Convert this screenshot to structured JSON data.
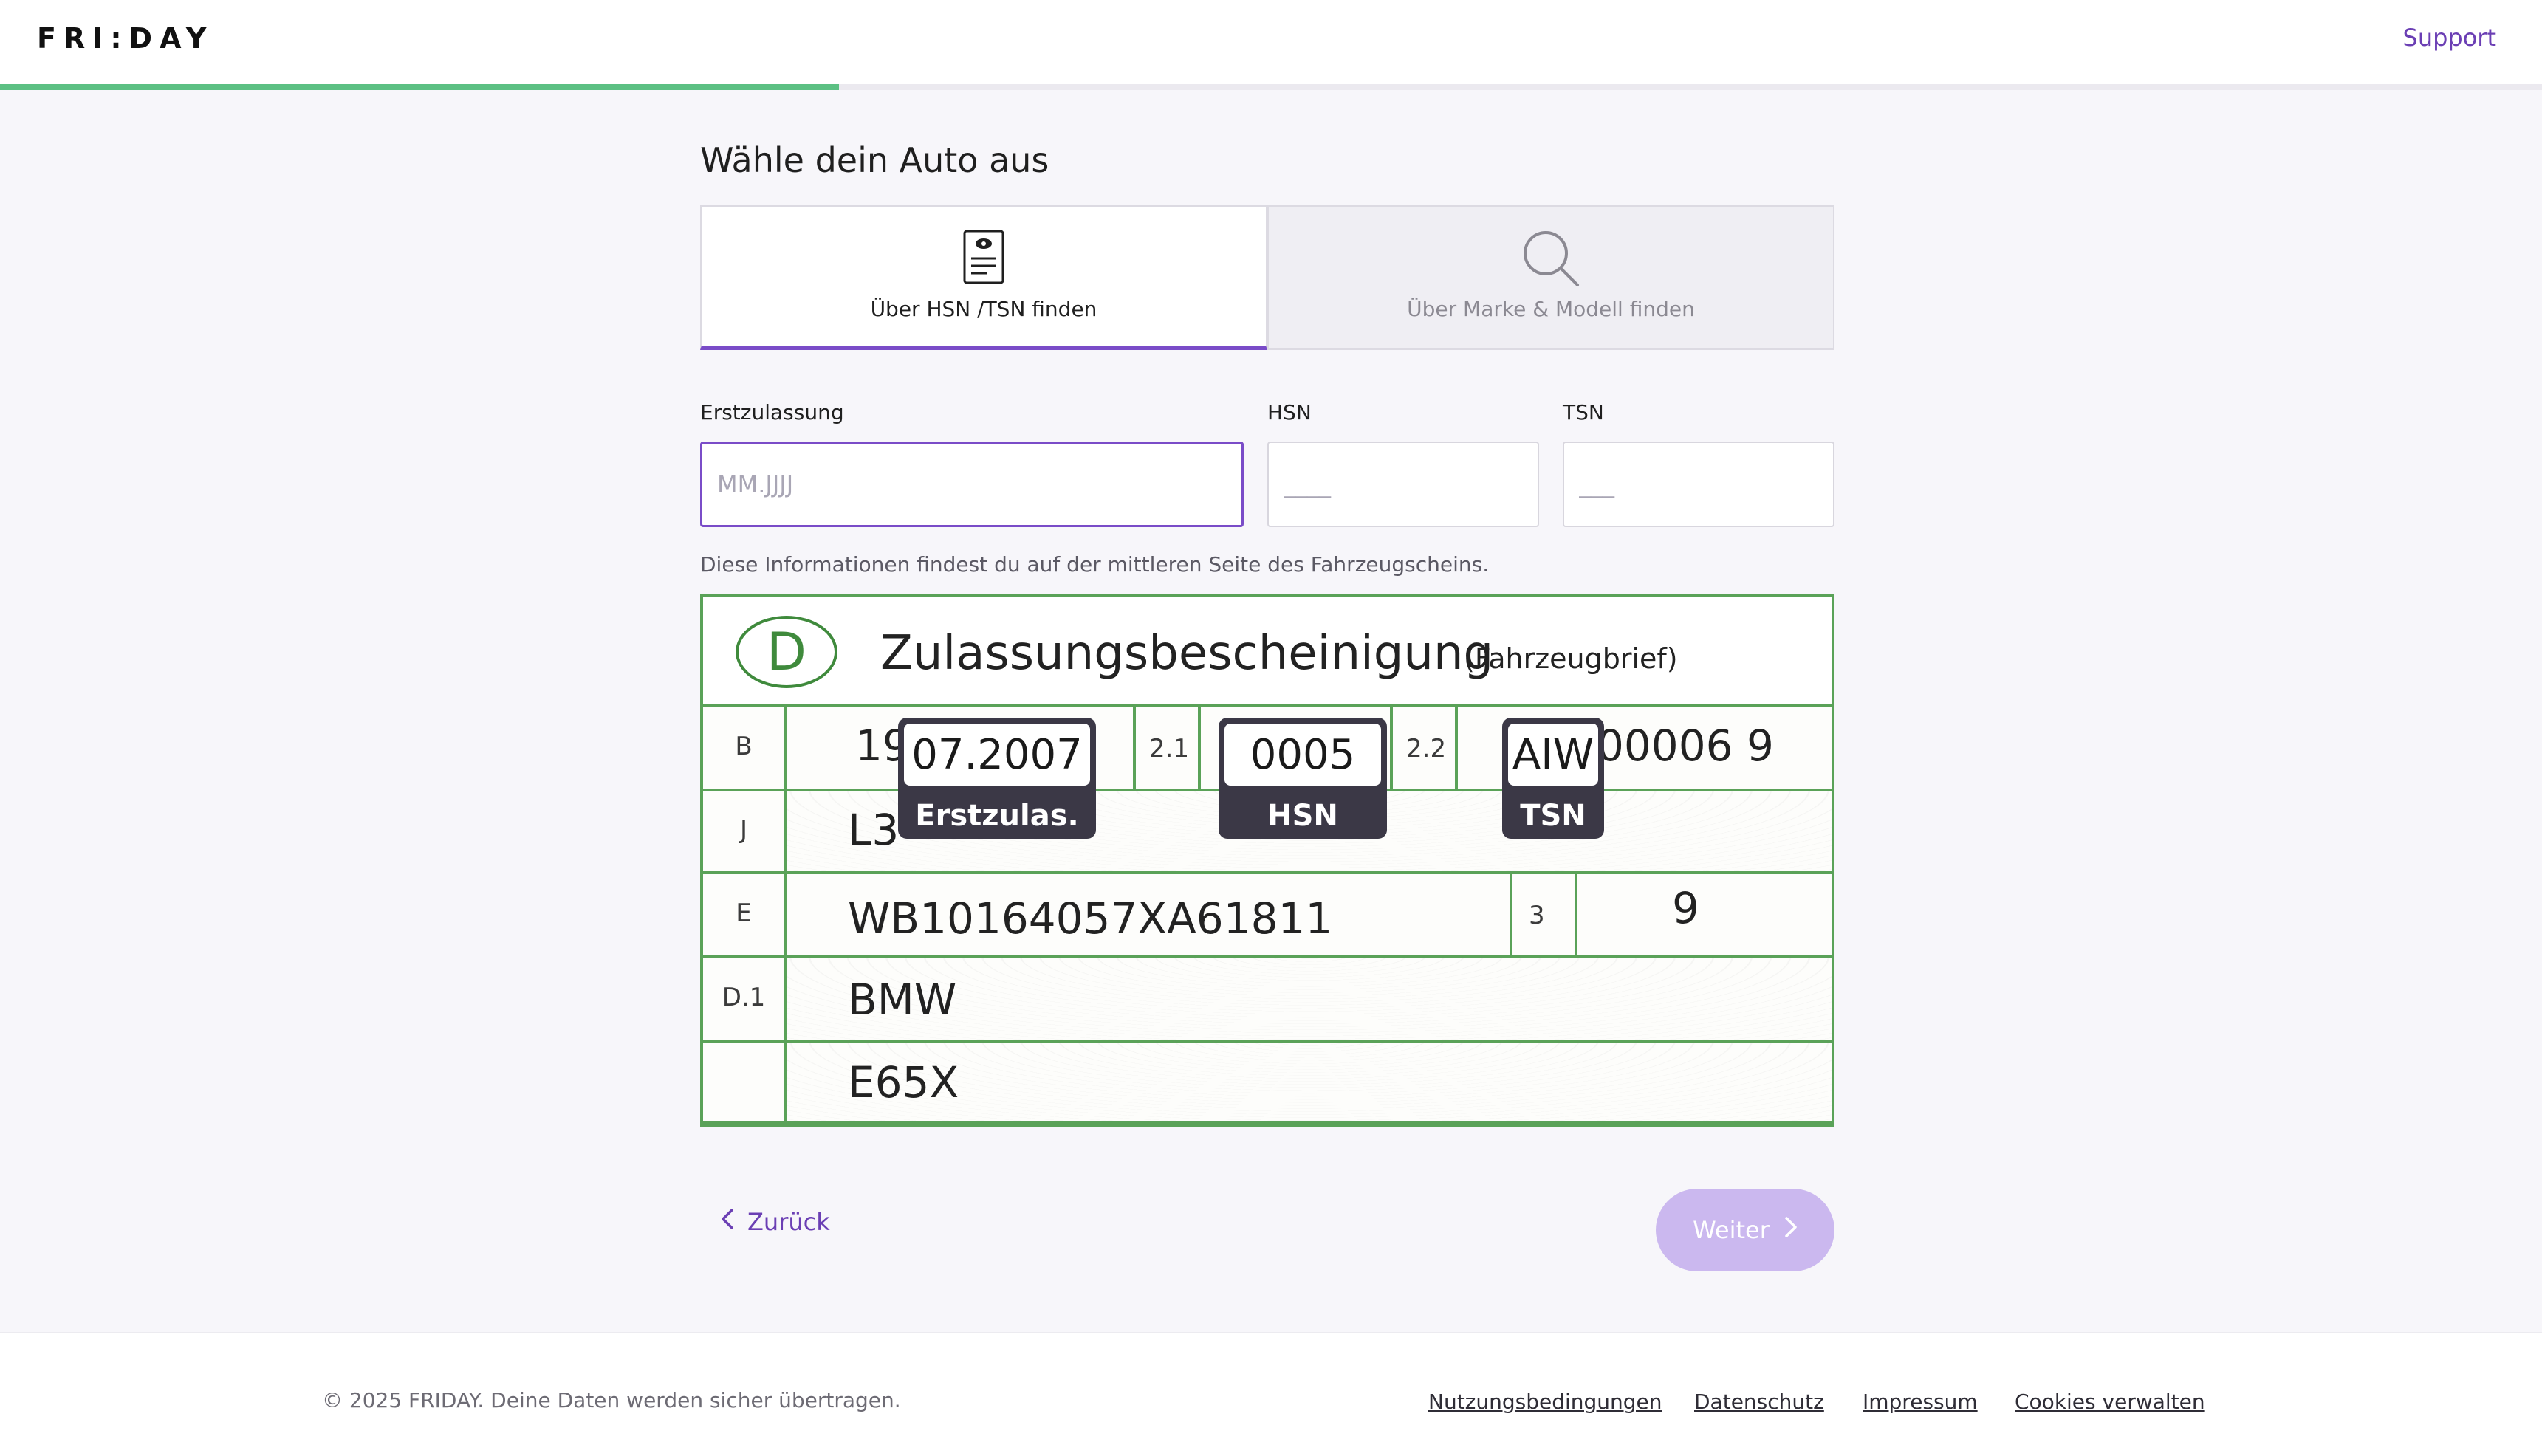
{
  "header": {
    "logo": "FRI:DAY",
    "support_label": "Support",
    "progress_fraction": 0.33
  },
  "main": {
    "title": "Wähle dein Auto aus",
    "tabs": [
      {
        "label": "Über HSN /TSN finden",
        "icon": "vehicle-document-icon",
        "active": true
      },
      {
        "label": "Über Marke & Modell finden",
        "icon": "search-icon",
        "active": false
      }
    ],
    "fields": {
      "registration": {
        "label": "Erstzulassung",
        "placeholder": "MM.JJJJ",
        "value": ""
      },
      "hsn": {
        "label": "HSN",
        "placeholder": "____",
        "value": ""
      },
      "tsn": {
        "label": "TSN",
        "placeholder": "___",
        "value": ""
      }
    },
    "hint": "Diese Informationen findest du auf der mittleren Seite des Fahrzeugscheins."
  },
  "document": {
    "badge_d": "D",
    "title": "Zulassungsbescheinigung",
    "subtitle": "(Fahrzeugbrief)",
    "rows": {
      "b": {
        "label": "B",
        "date_prefix": "19",
        "date": "07.2007",
        "num_21": "2.1",
        "hsn": "0005",
        "num_22": "2.2",
        "tsn": "AIW",
        "tsn_rest": "00006  9"
      },
      "j": {
        "label": "J",
        "value": "L3"
      },
      "e": {
        "label": "E",
        "value": "WB10164057XA61811",
        "num_3": "3",
        "value_3": "9"
      },
      "d1": {
        "label": "D.1",
        "value": "BMW"
      },
      "model": {
        "label": "",
        "value": "E65X"
      }
    },
    "badges": {
      "registration": "Erstzulas.",
      "hsn": "HSN",
      "tsn": "TSN"
    }
  },
  "nav": {
    "back_label": "Zurück",
    "next_label": "Weiter"
  },
  "footer": {
    "copyright": "© 2025 FRIDAY. Deine Daten werden sicher übertragen.",
    "links": [
      "Nutzungsbedingungen",
      "Datenschutz",
      "Impressum",
      "Cookies verwalten"
    ]
  },
  "colors": {
    "accent": "#7a4cc8",
    "progress": "#5cc083",
    "document_green": "#5aa258",
    "next_disabled": "#cbb8ef"
  }
}
